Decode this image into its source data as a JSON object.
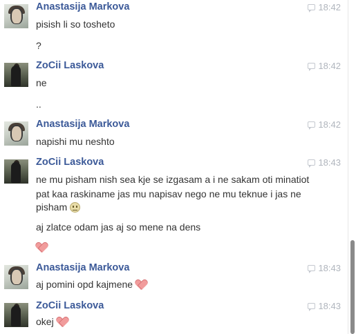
{
  "conversation": {
    "groups": [
      {
        "author": "Anastasija Markova",
        "time": "18:42",
        "avatar": "anastasija-avatar",
        "messages": [
          "pisish li so tosheto",
          "?"
        ]
      },
      {
        "author": "ZoCii Laskova",
        "time": "18:42",
        "avatar": "zocii-avatar",
        "messages": [
          "ne",
          ".."
        ]
      },
      {
        "author": "Anastasija Markova",
        "time": "18:42",
        "avatar": "anastasija-avatar",
        "messages": [
          "napishi mu neshto"
        ]
      },
      {
        "author": "ZoCii Laskova",
        "time": "18:43",
        "avatar": "zocii-avatar",
        "messages": [
          "ne mu pisham nish sea kje se izgasam a i ne sakam oti minatiot",
          "pat kaa raskiname jas mu napisav nego ne mu teknue i jas ne",
          "pisham",
          "aj zlatce odam jas aj so mene na dens"
        ]
      },
      {
        "author": "Anastasija Markova",
        "time": "18:43",
        "avatar": "anastasija-avatar",
        "messages": [
          "aj pomini opd kajmene"
        ]
      },
      {
        "author": "ZoCii Laskova",
        "time": "18:43",
        "avatar": "zocii-avatar",
        "messages": [
          "okej"
        ]
      }
    ],
    "icons": {
      "message": "chat-bubble-icon",
      "heart": "heart-emoticon",
      "smile": "smile-emoticon"
    },
    "colors": {
      "author_name": "#3b5998",
      "timestamp": "#b0b5bd",
      "message_text": "#333333",
      "heart": "#f19c9c"
    }
  }
}
